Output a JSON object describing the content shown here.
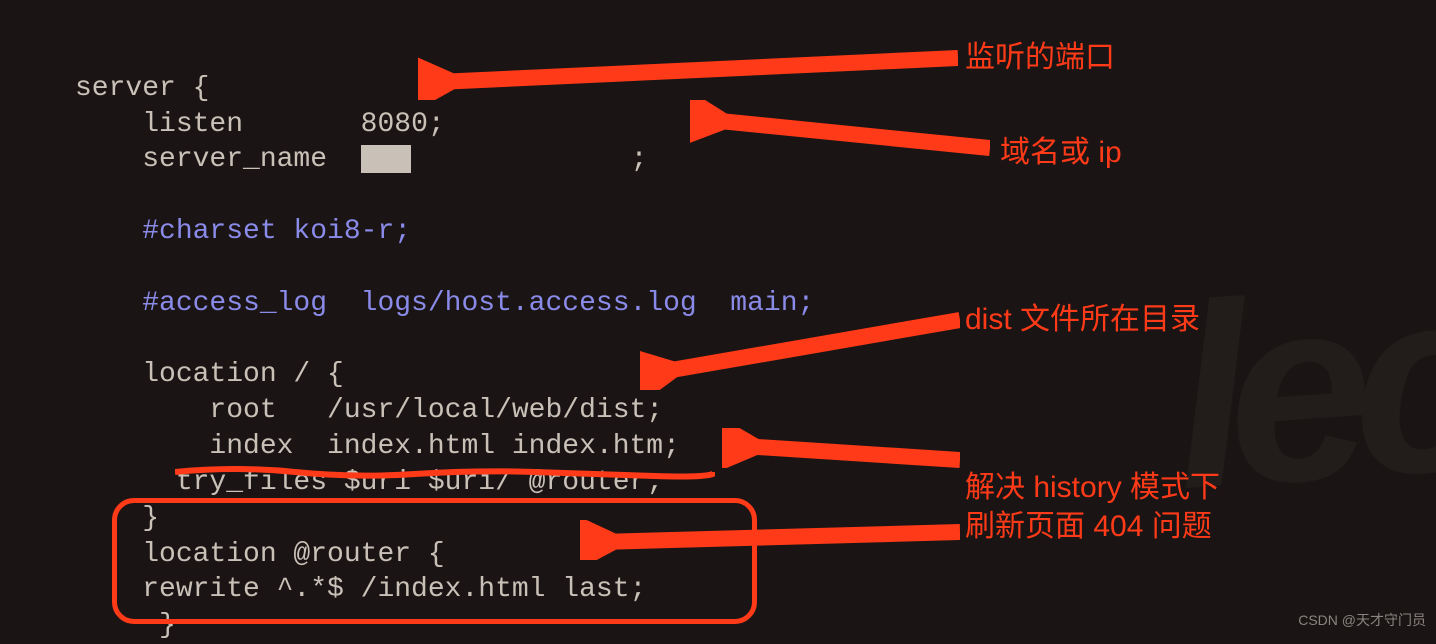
{
  "code": {
    "l1a": "server",
    "l1b": " {",
    "l2a": "    listen       ",
    "l2b": "8080",
    "l2c": ";",
    "l3a": "    server_name  ",
    "l3b": ";",
    "l5": "    #charset koi8-r;",
    "l7": "    #access_log  logs/host.access.log  main;",
    "l9": "    location / {",
    "l10": "        root   /usr/local/web/dist;",
    "l11": "        index  index.html index.htm;",
    "l12": "      try_files $uri $uri/ @router;",
    "l13": "    }",
    "l14": "    location @router {",
    "l15": "    rewrite ^.*$ /index.html last;",
    "l16": "     }"
  },
  "annotations": {
    "listen_port": "监听的端口",
    "server_name": "域名或 ip",
    "dist_dir": "dist 文件所在目录",
    "history_fix_l1": "解决 history 模式下",
    "history_fix_l2": "刷新页面 404 问题"
  },
  "watermark": "CSDN @天才守门员"
}
